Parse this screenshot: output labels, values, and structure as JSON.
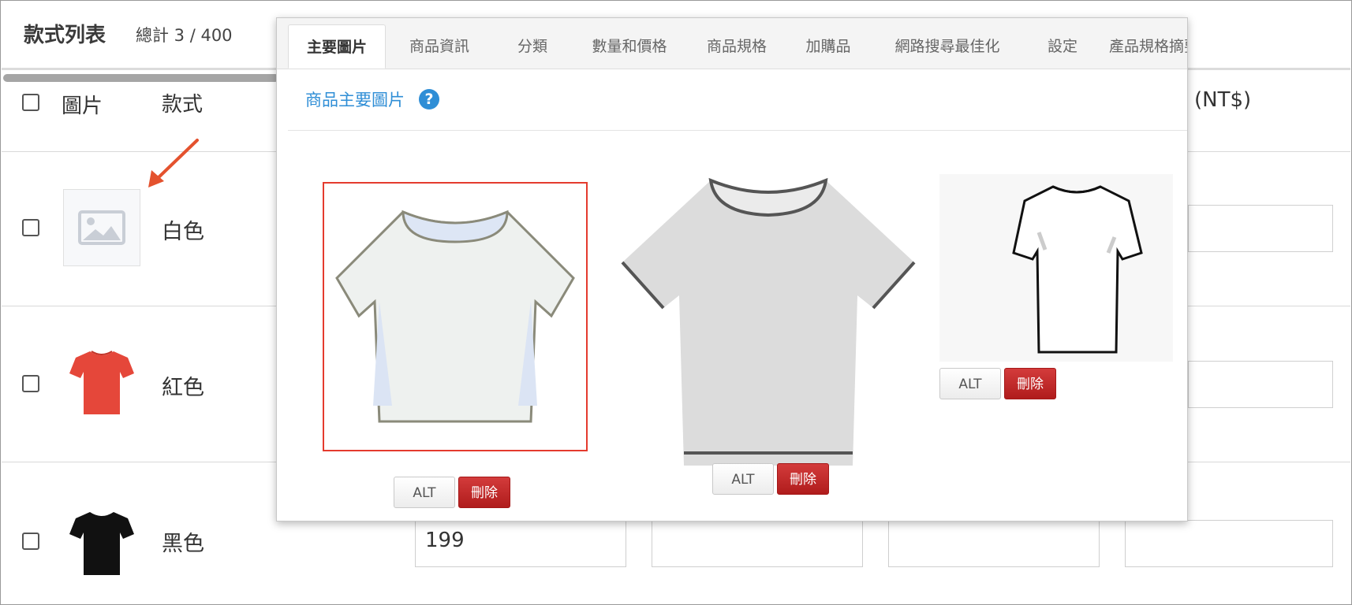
{
  "variant_list": {
    "title": "款式列表",
    "total": "總計 3 / 400"
  },
  "table": {
    "headers": {
      "image": "圖片",
      "variant": "款式",
      "price": "(NT$)"
    },
    "rows": [
      {
        "label": "白色",
        "image": "image-placeholder-icon"
      },
      {
        "label": "紅色",
        "image": "red-tshirt"
      },
      {
        "label": "黑色",
        "image": "black-tshirt",
        "price_value": "199"
      }
    ]
  },
  "modal": {
    "tabs": [
      {
        "label": "主要圖片",
        "active": true
      },
      {
        "label": "商品資訊"
      },
      {
        "label": "分類"
      },
      {
        "label": "數量和價格"
      },
      {
        "label": "商品規格"
      },
      {
        "label": "加購品"
      },
      {
        "label": "網路搜尋最佳化"
      },
      {
        "label": "設定"
      },
      {
        "label": "產品規格摘要"
      }
    ],
    "section_title": "商品主要圖片",
    "images": [
      {
        "name": "light-tshirt-drawing",
        "selected": true
      },
      {
        "name": "gray-tshirt"
      },
      {
        "name": "white-tshirt-outline"
      }
    ],
    "alt_label": "ALT",
    "delete_label": "刪除"
  },
  "colors": {
    "accent_blue": "#2f8ed6",
    "delete_red": "#b01c1c",
    "selection_red": "#e43b2e",
    "arrow": "#e4522e"
  }
}
